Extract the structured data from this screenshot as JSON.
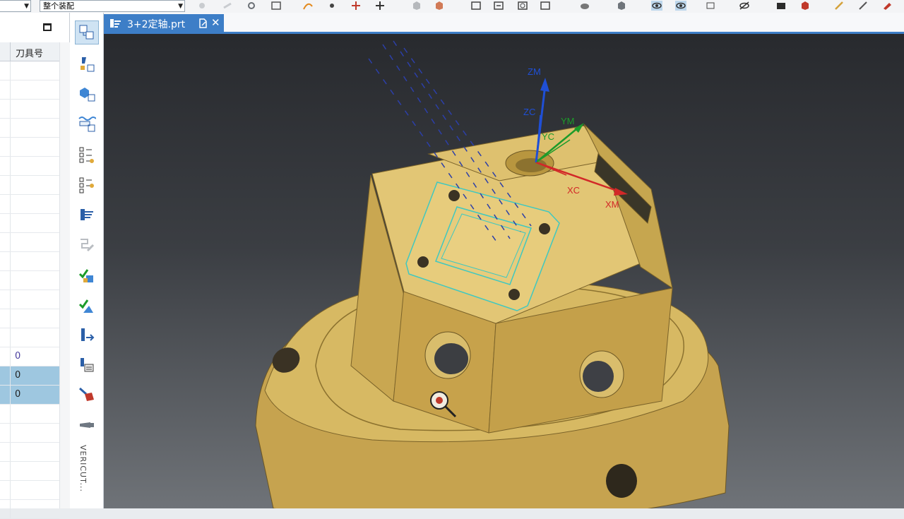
{
  "toolbar": {
    "combo_left_value": "",
    "combo_assembly_value": "整个装配",
    "colors": {
      "eye_active": "#bcd6ec"
    }
  },
  "navigator": {
    "column_header": "刀具号",
    "rows": [
      {
        "value": "",
        "selected": false
      },
      {
        "value": "",
        "selected": false
      },
      {
        "value": "",
        "selected": false
      },
      {
        "value": "",
        "selected": false
      },
      {
        "value": "",
        "selected": false
      },
      {
        "value": "",
        "selected": false
      },
      {
        "value": "",
        "selected": false
      },
      {
        "value": "",
        "selected": false
      },
      {
        "value": "",
        "selected": false
      },
      {
        "value": "",
        "selected": false
      },
      {
        "value": "",
        "selected": false
      },
      {
        "value": "",
        "selected": false
      },
      {
        "value": "",
        "selected": false
      },
      {
        "value": "",
        "selected": false
      },
      {
        "value": "",
        "selected": false
      },
      {
        "value": "0",
        "selected": false
      },
      {
        "value": "0",
        "selected": true
      },
      {
        "value": "0",
        "selected": true
      },
      {
        "value": "",
        "selected": false
      },
      {
        "value": "",
        "selected": false
      },
      {
        "value": "",
        "selected": false
      },
      {
        "value": "",
        "selected": false
      },
      {
        "value": "",
        "selected": false
      },
      {
        "value": "",
        "selected": false
      }
    ]
  },
  "op_toolbar": {
    "vericut_label": "VERICUT..."
  },
  "tab": {
    "label": "3+2定轴.prt"
  },
  "viewport": {
    "axes": {
      "zm": "ZM",
      "zc": "ZC",
      "ym": "YM",
      "yc": "YC",
      "xc": "XC",
      "xm": "XM"
    },
    "colors": {
      "part": "#d6b65e",
      "part_dark": "#9c8035",
      "z_axis": "#1f4fd6",
      "y_axis": "#1c9b2a",
      "x_axis": "#d22828",
      "toolpath": "#2c3fa8",
      "edge_cyan": "#3fc8c0"
    }
  }
}
